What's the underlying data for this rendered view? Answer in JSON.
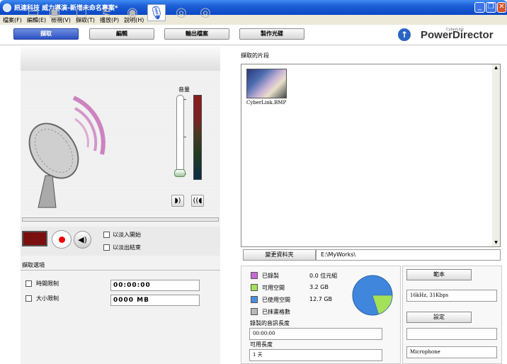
{
  "window": {
    "title": "訊連科技 威力導演-新增未命名專案*"
  },
  "menu": [
    "檔案(F)",
    "編輯(E)",
    "檢視(V)",
    "擷取(T)",
    "播放(P)",
    "說明(H)"
  ],
  "tabs": {
    "capture": "擷取",
    "edit": "編輯",
    "output": "輸出檔案",
    "burn": "製作光碟"
  },
  "brand": {
    "name": "PowerDirector",
    "small": "CyberLink"
  },
  "capture": {
    "volume_label": "音量",
    "fade_in": "以淡入開始",
    "fade_out": "以淡出結束",
    "options_header": "擷取選項",
    "time_limit_label": "時間限制",
    "time_limit_value": "00:00:00",
    "size_limit_label": "大小限制",
    "size_limit_value": "0000 MB"
  },
  "clips": {
    "label": "擷取的片段",
    "items": [
      {
        "name": "CyberLink.BMP"
      }
    ],
    "change_folder": "變更資料夾",
    "path": "E:\\MyWorks\\"
  },
  "disk": {
    "rows": [
      {
        "label": "已錄製",
        "value": "0.0 位元組",
        "color": "#c86ad8"
      },
      {
        "label": "可用空間",
        "value": "3.2 GB",
        "color": "#a5e05a"
      },
      {
        "label": "已使用空間",
        "value": "12.7 GB",
        "color": "#4a8ee0"
      },
      {
        "label": "已抹畫格數",
        "value": "",
        "color": "#b8b8b8"
      }
    ],
    "recorded_length_label": "錄製的音訊長度",
    "recorded_length_value": "00:00:00",
    "available_length_label": "可用長度",
    "available_length_value": "1 天",
    "used_fraction": 0.8
  },
  "audio": {
    "sample_button": "範本",
    "sample_value": "16kHz, 31Kbps",
    "settings_button": "設定",
    "settings_value": "",
    "device": "Microphone"
  }
}
